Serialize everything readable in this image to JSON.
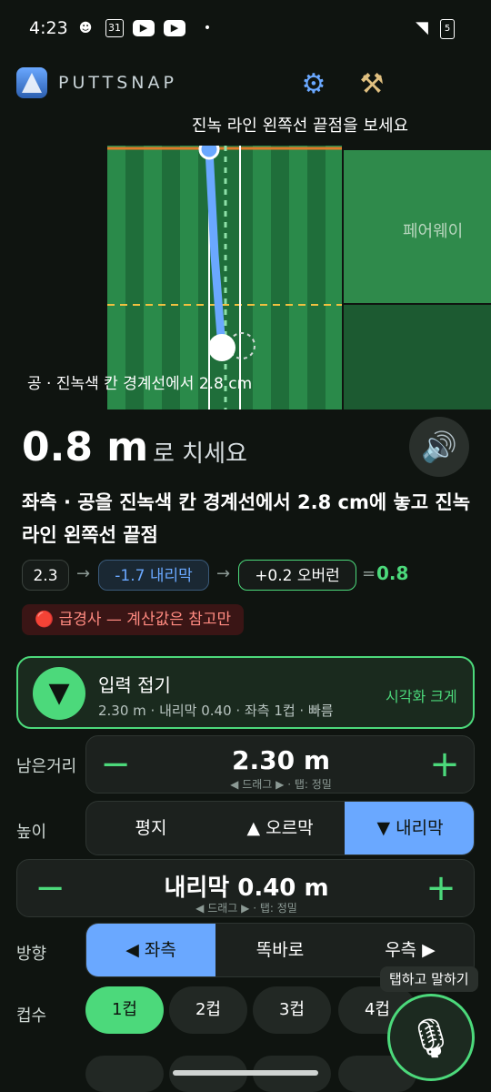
{
  "status": {
    "time": "4:23",
    "calendar_day": "31",
    "battery_level": "5"
  },
  "header": {
    "brand": "PUTTSNAP",
    "settings_icon": "gear-icon",
    "tools_icon": "tools-icon"
  },
  "visual": {
    "hint": "진녹 라인 왼쪽선 끝점을 보세요",
    "fairway_label": "페어웨이",
    "ball_label": "공 · 진녹색 칸 경계선에서 2.8 cm"
  },
  "result": {
    "distance": "0.8 m",
    "distance_suffix": "로 치세요",
    "instruction": "좌측 · 공을 진녹색 칸 경계선에서 2.8 cm에 놓고 진녹 라인 왼쪽선 끝점"
  },
  "formula": {
    "base": "2.3",
    "slope": "-1.7 내리막",
    "overrun": "+0.2 오버런",
    "equals": "=",
    "result": "0.8"
  },
  "warning": "🔴 급경사 — 계산값은 참고만",
  "collapse": {
    "title": "입력 접기",
    "summary": "2.30 m · 내리막 0.40 · 좌측 1컵 · 빠름",
    "link": "시각화 크게"
  },
  "inputs": {
    "remaining_label": "남은거리",
    "remaining_value": "2.30 m",
    "drag_hint": "◀ 드래그 ▶ · 탭: 정밀",
    "minus": "−",
    "plus": "+",
    "height_label": "높이",
    "height_options": [
      "평지",
      "▲ 오르막",
      "▼ 내리막"
    ],
    "height_selected": "▼ 내리막",
    "slope_value": "내리막 0.40 m",
    "direction_label": "방향",
    "direction_options": [
      "◀ 좌측",
      "똑바로",
      "우측 ▶"
    ],
    "direction_selected": "◀ 좌측",
    "cups_label": "컵수",
    "cups": [
      "1컵",
      "2컵",
      "3컵",
      "4컵"
    ],
    "cups_selected": "1컵"
  },
  "voice": {
    "tooltip": "탭하고 말하기",
    "icon": "microphone-icon"
  },
  "colors": {
    "accent": "#4cd97b",
    "selected_blue": "#6aa8ff",
    "warning": "#ff8a80"
  }
}
